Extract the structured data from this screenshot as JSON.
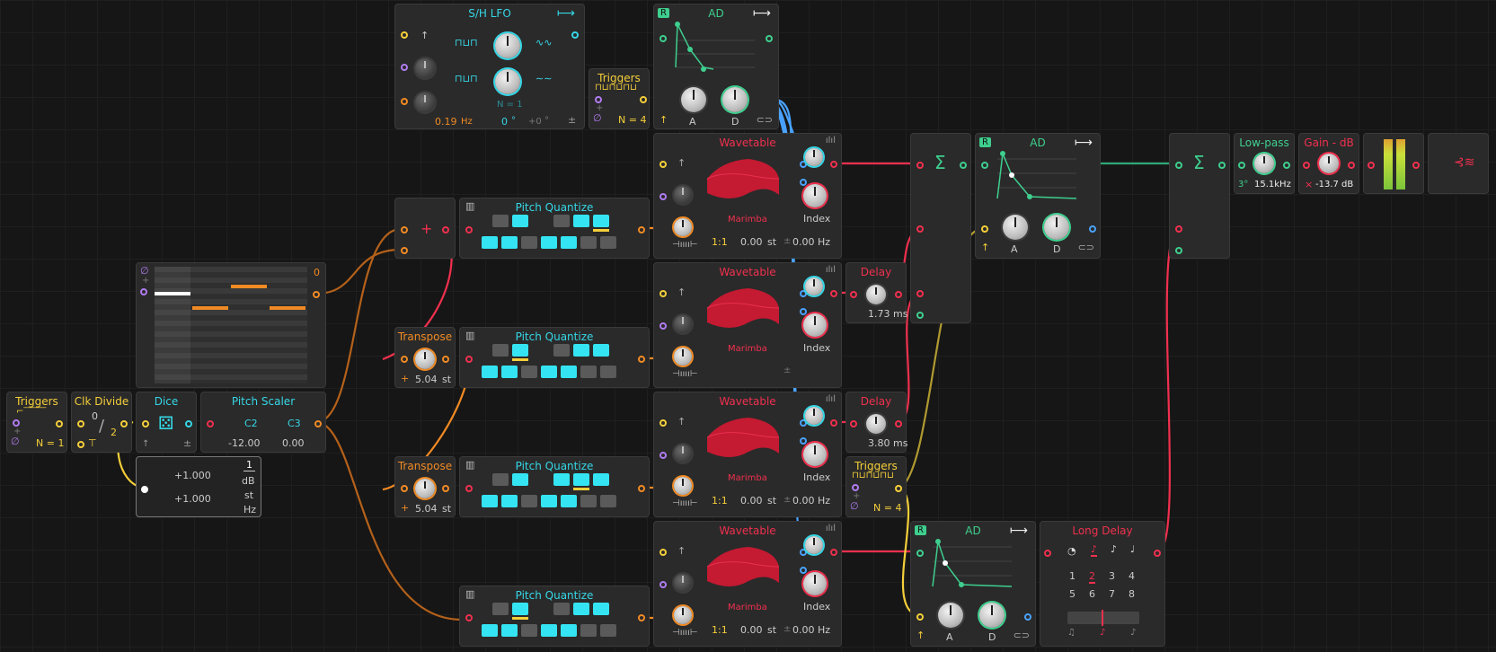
{
  "colors": {
    "cyan": "#35d7e6",
    "yellow": "#f5cf3a",
    "red": "#f0304e",
    "orange": "#f08a24",
    "green": "#3ecf8e",
    "blue": "#4aa3ff",
    "bg": "#161616"
  },
  "sh_lfo": {
    "title": "S/H LFO",
    "rate": "0.19",
    "rate_unit": "Hz",
    "phase": "0",
    "phase_unit": "°",
    "offset": "+0",
    "offset_unit": "°",
    "n": "N = 1",
    "bipolar": "±"
  },
  "triggers_top": {
    "title": "Triggers",
    "n": "N = 4"
  },
  "ad_top": {
    "title": "AD",
    "badge": "R",
    "a": "A",
    "d": "D"
  },
  "wavetables": [
    {
      "title": "Wavetable",
      "preset": "Marimba",
      "ratio": "1:1",
      "st": "0.00",
      "st_unit": "st",
      "hz": "0.00 Hz",
      "index": "Index"
    },
    {
      "title": "Wavetable",
      "preset": "Marimba",
      "ratio": "",
      "st": "",
      "st_unit": "",
      "hz": "",
      "index": "Index"
    },
    {
      "title": "Wavetable",
      "preset": "Marimba",
      "ratio": "1:1",
      "st": "0.00",
      "st_unit": "st",
      "hz": "0.00 Hz",
      "index": "Index"
    },
    {
      "title": "Wavetable",
      "preset": "Marimba",
      "ratio": "1:1",
      "st": "0.00",
      "st_unit": "st",
      "hz": "0.00 Hz",
      "index": "Index"
    }
  ],
  "pitch_quantize_title": "Pitch Quantize",
  "add": {
    "symbol": "+"
  },
  "transpose": [
    {
      "title": "Transpose",
      "value": "5.04",
      "unit": "st"
    },
    {
      "title": "Transpose",
      "value": "5.04",
      "unit": "st"
    }
  ],
  "seq": {
    "value": "0"
  },
  "triggers_left": {
    "title": "Triggers",
    "n": "N = 1"
  },
  "clk_divide": {
    "title": "Clk Divide",
    "top": "0",
    "bottom": "2"
  },
  "dice": {
    "title": "Dice",
    "bipolar": "±"
  },
  "pitch_scaler": {
    "title": "Pitch Scaler",
    "low": "C2",
    "high": "C3",
    "low_val": "-12.00",
    "high_val": "0.00"
  },
  "scale_box": {
    "v1": "+1.000",
    "v2": "+1.000",
    "num": "1",
    "units": [
      "dB",
      "st",
      "Hz"
    ]
  },
  "delay1": {
    "title": "Delay",
    "value": "1.73 ms"
  },
  "delay2": {
    "title": "Delay",
    "value": "3.80 ms"
  },
  "triggers_mid": {
    "title": "Triggers",
    "n": "N = 4"
  },
  "sum1": {
    "symbol": "Σ"
  },
  "ad_mid": {
    "title": "AD",
    "badge": "R",
    "a": "A",
    "d": "D"
  },
  "sum2": {
    "symbol": "Σ"
  },
  "lowpass": {
    "title": "Low-pass",
    "slope": "3°",
    "freq": "15.1kHz"
  },
  "gain": {
    "title": "Gain - dB",
    "value": "-13.7 dB",
    "x": "×"
  },
  "ad_bottom": {
    "title": "AD",
    "badge": "R",
    "a": "A",
    "d": "D"
  },
  "long_delay": {
    "title": "Long Delay",
    "grid": [
      "1",
      "2",
      "3",
      "4",
      "5",
      "6",
      "7",
      "8"
    ]
  }
}
